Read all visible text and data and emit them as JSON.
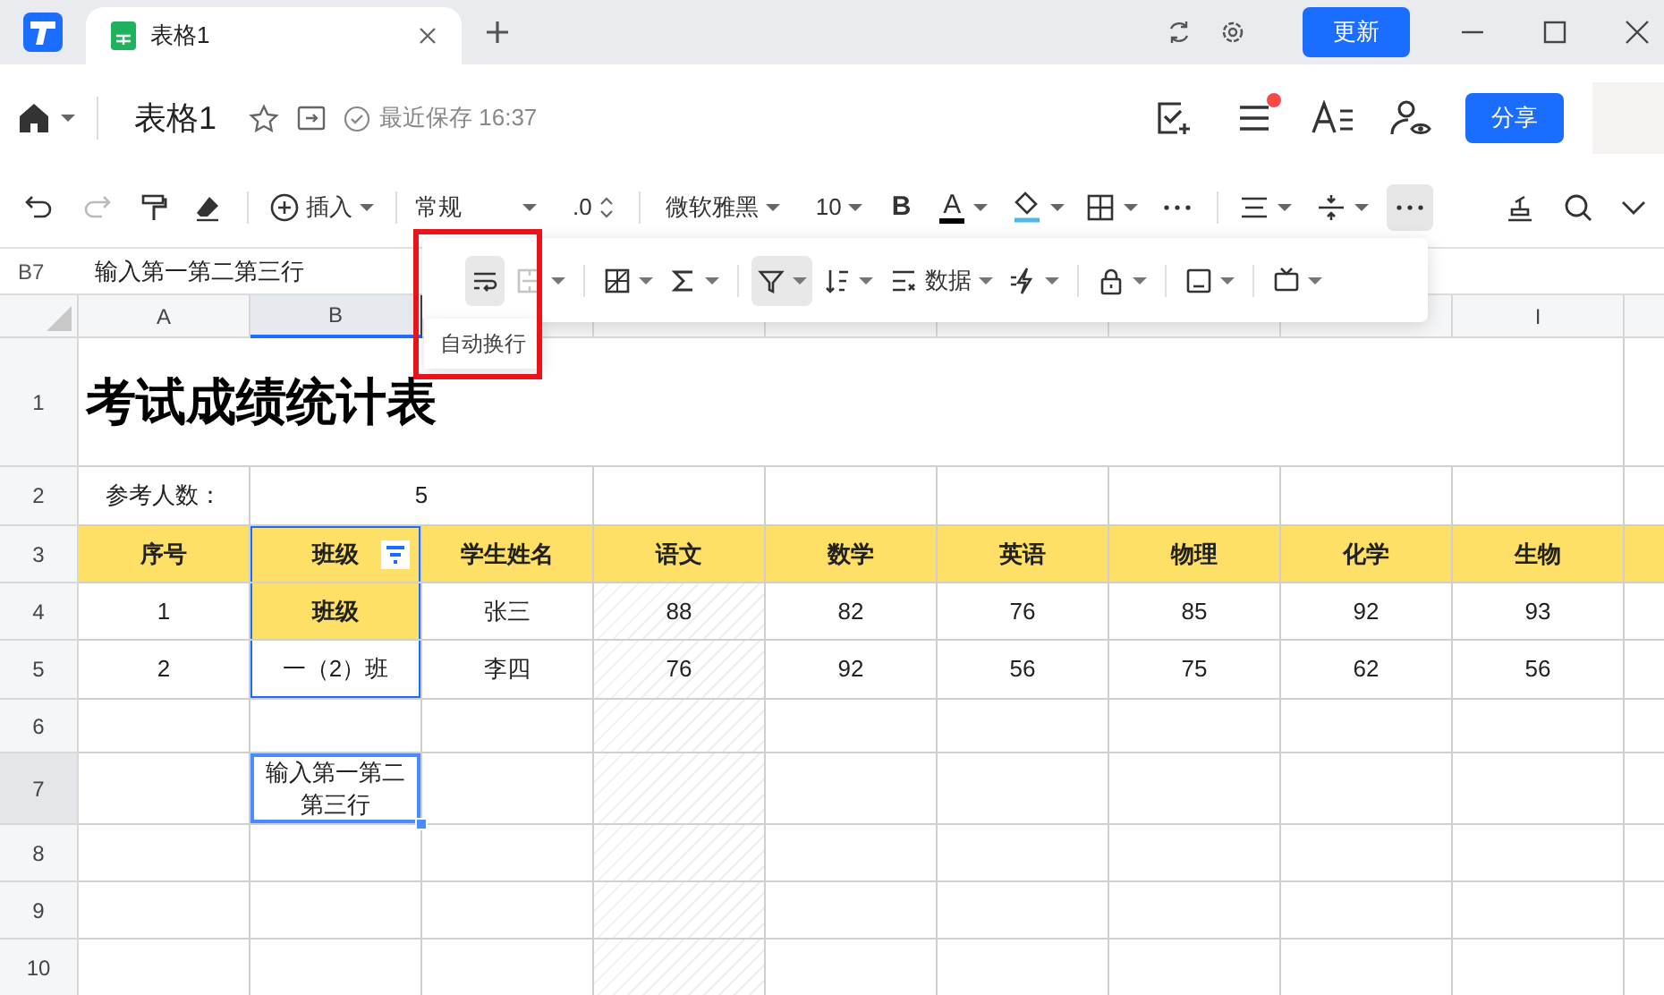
{
  "app_tabs": [
    {
      "title": "表格1",
      "selected": true
    }
  ],
  "update_button": "更新",
  "document": {
    "title": "表格1",
    "save_status": "最近保存 16:37",
    "share_button": "分享",
    "notification_dot": true
  },
  "toolbar": {
    "insert": "插入",
    "number_format": "常规",
    "decimal": ".0",
    "font": "微软雅黑",
    "font_size": "10",
    "bold": "B",
    "font_color": "A",
    "more_active": true
  },
  "formula_bar": {
    "cell": "B7",
    "value": "输入第一第二第三行"
  },
  "popup_toolbar": [
    {
      "kind": "wrap",
      "active": true,
      "disabled": false,
      "dropdown": false
    },
    {
      "kind": "merge",
      "active": false,
      "disabled": true,
      "dropdown": true
    },
    {
      "kind": "cell_style",
      "active": false,
      "disabled": false,
      "dropdown": true
    },
    {
      "kind": "sum",
      "active": false,
      "disabled": false,
      "dropdown": true
    },
    {
      "kind": "filter",
      "active": true,
      "disabled": false,
      "dropdown": true
    },
    {
      "kind": "sort",
      "active": false,
      "disabled": false,
      "dropdown": true
    },
    {
      "kind": "data",
      "label": "数据",
      "active": false,
      "disabled": false,
      "dropdown": true
    },
    {
      "kind": "flash",
      "active": false,
      "disabled": false,
      "dropdown": true
    },
    {
      "kind": "lock",
      "active": false,
      "disabled": false,
      "dropdown": true
    },
    {
      "kind": "freeze",
      "active": false,
      "disabled": false,
      "dropdown": true
    },
    {
      "kind": "view",
      "active": false,
      "disabled": false,
      "dropdown": true
    }
  ],
  "tooltip": "自动换行",
  "sheet": {
    "columns": [
      {
        "label": "A",
        "selected": false,
        "hatched": false
      },
      {
        "label": "B",
        "selected": true,
        "hatched": false
      },
      {
        "selected": false,
        "hatched": false
      },
      {
        "selected": false,
        "hatched": true
      },
      {
        "selected": false,
        "hatched": false
      },
      {
        "selected": false,
        "hatched": false
      },
      {
        "selected": false,
        "hatched": false
      },
      {
        "selected": false,
        "hatched": false
      },
      {
        "label": "I",
        "selected": false,
        "hatched": false
      }
    ],
    "rows": [
      {
        "label": "1",
        "selected": false,
        "kind": "title",
        "cells": [
          {
            "text": "考试成绩统计表"
          }
        ]
      },
      {
        "label": "2",
        "selected": false,
        "kind": "info",
        "cells": [
          {
            "text": "参考人数："
          },
          {
            "text": "5",
            "merged_with_next": true
          },
          null,
          null,
          null,
          null,
          null,
          null,
          null
        ]
      },
      {
        "label": "3",
        "selected": false,
        "kind": "header",
        "cells": [
          {
            "text": "序号"
          },
          {
            "text": "班级",
            "filter_button": true,
            "range": true
          },
          {
            "text": "学生姓名"
          },
          {
            "text": "语文"
          },
          {
            "text": "数学"
          },
          {
            "text": "英语"
          },
          {
            "text": "物理"
          },
          {
            "text": "化学"
          },
          {
            "text": "生物"
          }
        ]
      },
      {
        "label": "4",
        "selected": false,
        "kind": "data",
        "cells": [
          {
            "text": "1"
          },
          {
            "text": "班级",
            "highlight": true,
            "range": true
          },
          {
            "text": "张三"
          },
          {
            "text": "88"
          },
          {
            "text": "82"
          },
          {
            "text": "76"
          },
          {
            "text": "85"
          },
          {
            "text": "92"
          },
          {
            "text": "93"
          }
        ]
      },
      {
        "label": "5",
        "selected": false,
        "kind": "data",
        "cells": [
          {
            "text": "2"
          },
          {
            "text": "一（2）班",
            "range": true
          },
          {
            "text": "李四"
          },
          {
            "text": "76"
          },
          {
            "text": "92"
          },
          {
            "text": "56"
          },
          {
            "text": "75"
          },
          {
            "text": "62"
          },
          {
            "text": "56"
          }
        ]
      },
      {
        "label": "6",
        "selected": false,
        "kind": "data",
        "cells": [
          null,
          null,
          null,
          null,
          null,
          null,
          null,
          null,
          null
        ]
      },
      {
        "label": "7",
        "selected": true,
        "kind": "data",
        "cells": [
          null,
          {
            "text": "输入第一第二第三行",
            "selected": true
          },
          null,
          null,
          null,
          null,
          null,
          null,
          null
        ]
      },
      {
        "label": "8",
        "selected": false,
        "kind": "data",
        "cells": [
          null,
          null,
          null,
          null,
          null,
          null,
          null,
          null,
          null
        ]
      },
      {
        "label": "9",
        "selected": false,
        "kind": "data",
        "cells": [
          null,
          null,
          null,
          null,
          null,
          null,
          null,
          null,
          null
        ]
      },
      {
        "label": "10",
        "selected": false,
        "kind": "data",
        "cells": [
          null,
          null,
          null,
          null,
          null,
          null,
          null,
          null,
          null
        ]
      }
    ]
  }
}
